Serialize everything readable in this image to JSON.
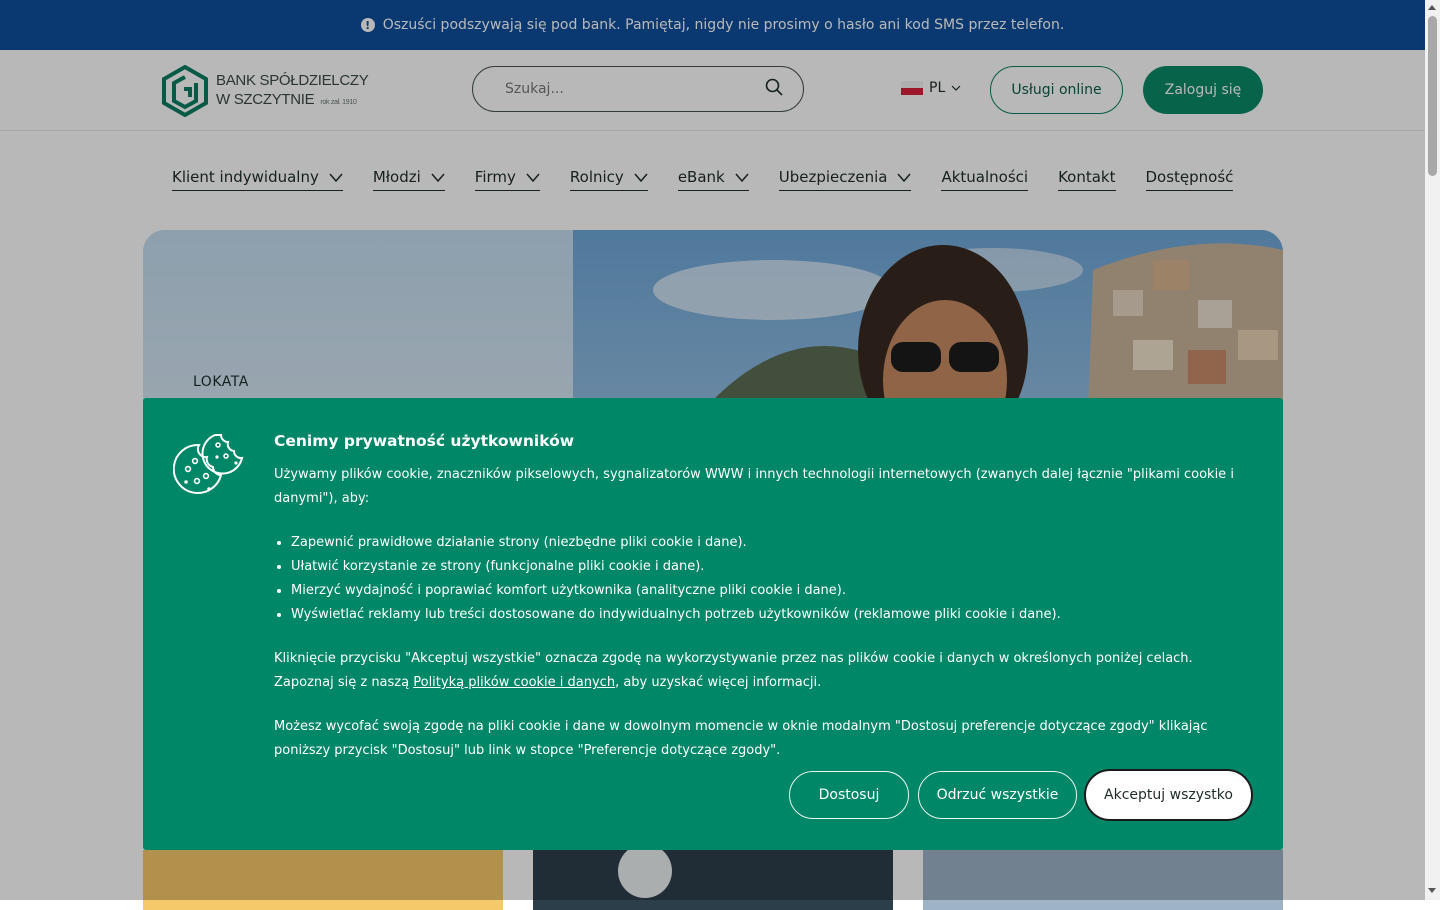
{
  "alert": {
    "icon": "info-icon",
    "text": "Oszuści podszywają się pod bank. Pamiętaj, nigdy nie prosimy o hasło ani kod SMS przez telefon."
  },
  "header": {
    "logo": {
      "line1": "BANK SPÓŁDZIELCZY",
      "line2": "W SZCZYTNIE",
      "est": "rok zał. 1910"
    },
    "search": {
      "placeholder": "Szukaj...",
      "icon": "search-icon"
    },
    "language": {
      "code": "PL",
      "flag": "poland-flag-icon"
    },
    "online_services": "Usługi online",
    "login": "Zaloguj się"
  },
  "nav": {
    "items": [
      {
        "label": "Klient indywidualny",
        "has_dropdown": true
      },
      {
        "label": "Młodzi",
        "has_dropdown": true
      },
      {
        "label": "Firmy",
        "has_dropdown": true
      },
      {
        "label": "Rolnicy",
        "has_dropdown": true
      },
      {
        "label": "eBank",
        "has_dropdown": true
      },
      {
        "label": "Ubezpieczenia",
        "has_dropdown": true
      },
      {
        "label": "Aktualności",
        "has_dropdown": false
      },
      {
        "label": "Kontakt",
        "has_dropdown": false
      },
      {
        "label": "Dostępność",
        "has_dropdown": false
      }
    ]
  },
  "hero": {
    "kicker": "LOKATA"
  },
  "cookie": {
    "icon": "cookies-icon",
    "title": "Cenimy prywatność użytkowników",
    "intro": "Używamy plików cookie, znaczników pikselowych, sygnalizatorów WWW i innych technologii internetowych (zwanych dalej łącznie \"plikami cookie i danymi\"), aby:",
    "list": [
      "Zapewnić prawidłowe działanie strony (niezbędne pliki cookie i dane).",
      "Ułatwić korzystanie ze strony (funkcjonalne pliki cookie i dane).",
      "Mierzyć wydajność i poprawiać komfort użytkownika (analityczne pliki cookie i dane).",
      "Wyświetlać reklamy lub treści dostosowane do indywidualnych potrzeb użytkowników (reklamowe pliki cookie i dane)."
    ],
    "consent_prefix": "Kliknięcie przycisku \"Akceptuj wszystkie\" oznacza zgodę na wykorzystywanie przez nas plików cookie i danych w określonych poniżej celach. Zapoznaj się z naszą ",
    "policy_link": "Polityką plików cookie i danych",
    "consent_suffix": ", aby uzyskać więcej informacji.",
    "withdraw": "Możesz wycofać swoją zgodę na pliki cookie i dane w dowolnym momencie w oknie modalnym \"Dostosuj preferencje dotyczące zgody\" klikając poniższy przycisk \"Dostosuj\" lub link w stopce \"Preferencje dotyczące zgody\".",
    "buttons": {
      "customize": "Dostosuj",
      "reject": "Odrzuć wszystkie",
      "accept": "Akceptuj wszystko"
    }
  },
  "colors": {
    "alert_bg": "#0f4f9e",
    "brand_green": "#0a8a67",
    "cookie_bg": "#008767"
  }
}
